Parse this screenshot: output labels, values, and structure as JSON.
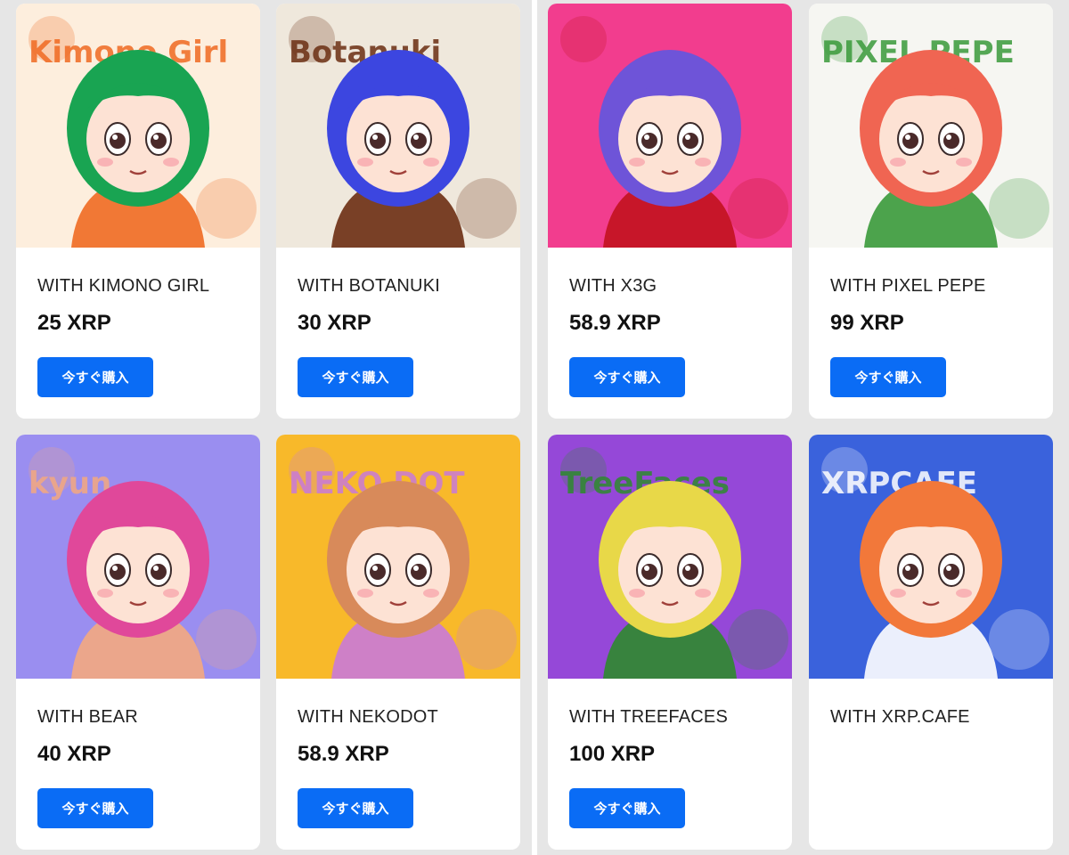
{
  "products": [
    {
      "title": "WITH KIMONO GIRL",
      "price": "25 XRP",
      "button_label": "今すぐ購入",
      "image_text": "Kimono Girl",
      "bg": "#fdeedd",
      "hair": "#19a452",
      "accent": "#f06a22"
    },
    {
      "title": "WITH BOTANUKI",
      "price": "30 XRP",
      "button_label": "今すぐ購入",
      "image_text": "Botanuki",
      "bg": "#efe8dc",
      "hair": "#3c46e0",
      "accent": "#6b2e12"
    },
    {
      "title": "WITH X3G",
      "price": "58.9 XRP",
      "button_label": "今すぐ購入",
      "image_text": "",
      "bg": "#f23d8e",
      "hair": "#6e54d8",
      "accent": "#c2121e"
    },
    {
      "title": "WITH PIXEL PEPE",
      "price": "99 XRP",
      "button_label": "今すぐ購入",
      "image_text": "PIXEL PEPE",
      "bg": "#f6f6f2",
      "hair": "#f06552",
      "accent": "#3a9a3a"
    },
    {
      "title": "WITH BEAR",
      "price": "40 XRP",
      "button_label": "今すぐ購入",
      "image_text": "kyun",
      "bg": "#9a8ef0",
      "hair": "#e0489a",
      "accent": "#f4a880"
    },
    {
      "title": "WITH NEKODOT",
      "price": "58.9 XRP",
      "button_label": "今すぐ購入",
      "image_text": "NEKO DOT",
      "bg": "#f8b92a",
      "hair": "#d88a5a",
      "accent": "#c97ad8"
    },
    {
      "title": "WITH TREEFACES",
      "price": "100 XRP",
      "button_label": "今すぐ購入",
      "image_text": "TreeFaces",
      "bg": "#9548d8",
      "hair": "#e8d848",
      "accent": "#2e8a2e"
    },
    {
      "title": "WITH XRP.CAFE",
      "price": "",
      "button_label": "",
      "image_text": "XRPCAFE",
      "bg": "#3a62dc",
      "hair": "#f2783a",
      "accent": "#ffffff"
    }
  ]
}
